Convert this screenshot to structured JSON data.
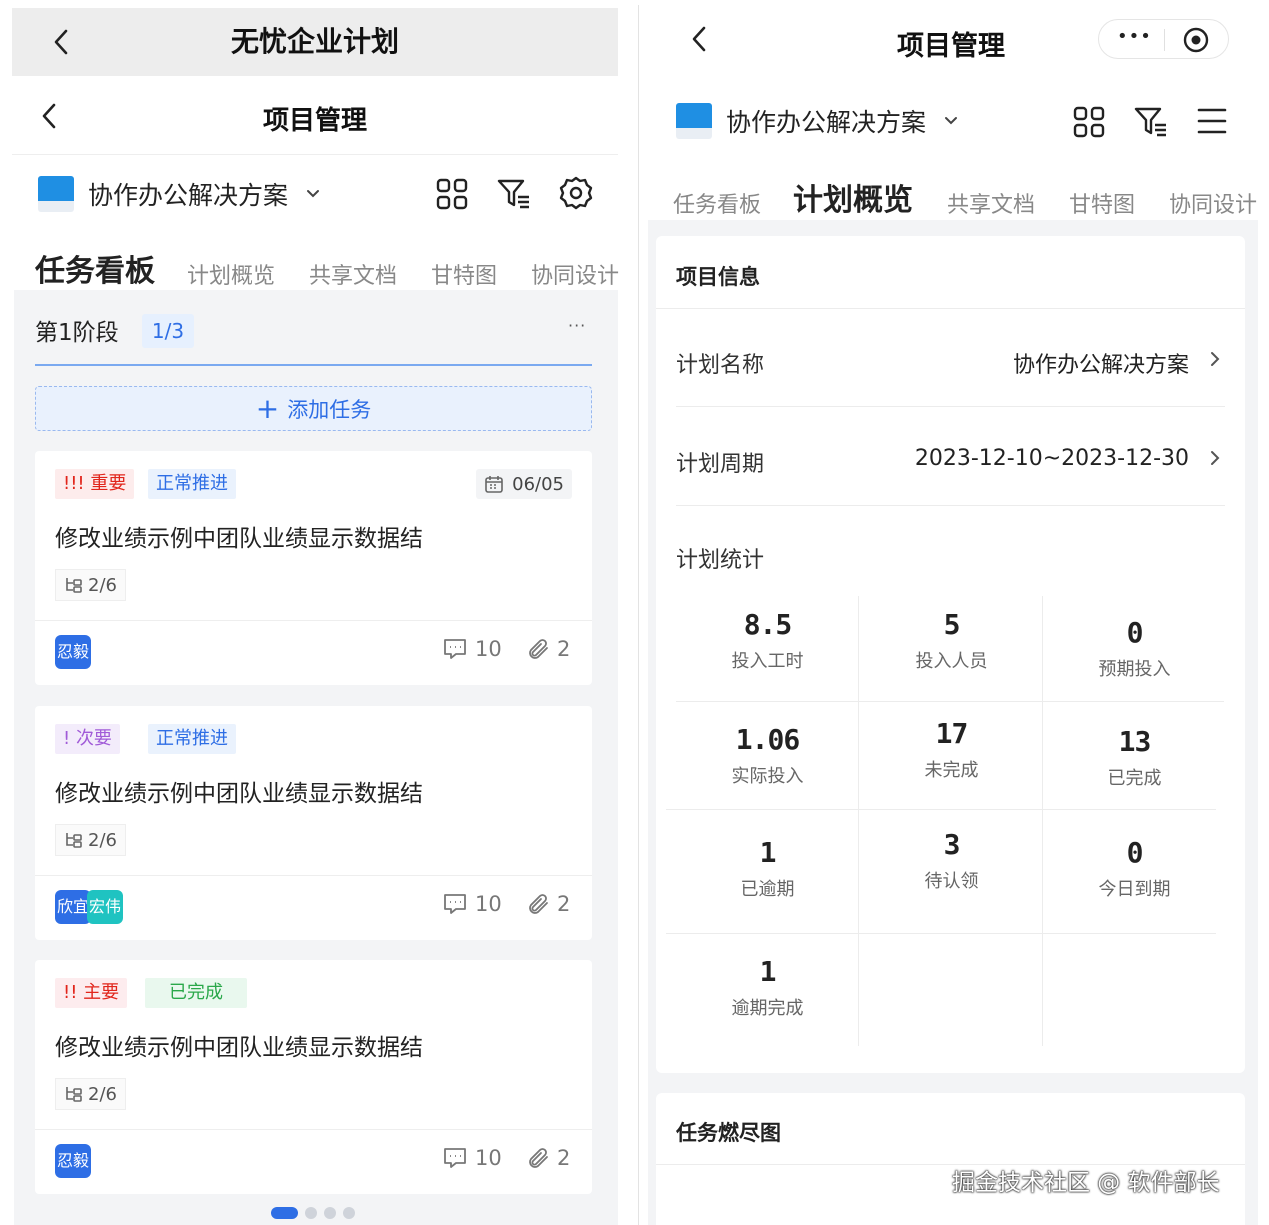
{
  "left": {
    "wechat_title": "无忧企业计划",
    "page_title": "项目管理",
    "project_name": "协作办公解决方案",
    "tabs": [
      "任务看板",
      "计划概览",
      "共享文档",
      "甘特图",
      "协同设计"
    ],
    "stage": {
      "title": "第1阶段",
      "badge": "1/3",
      "more": "···"
    },
    "add_task": "添加任务",
    "cards": [
      {
        "priority": "!!! 重要",
        "status": "正常推进",
        "date": "06/05",
        "title": "修改业绩示例中团队业绩显示数据结",
        "subtasks": "2/6",
        "avatars": [
          "忍毅"
        ],
        "comments": "10",
        "attachments": "2"
      },
      {
        "priority": "! 次要",
        "status": "正常推进",
        "title": "修改业绩示例中团队业绩显示数据结",
        "subtasks": "2/6",
        "avatars": [
          "欣宜",
          "宏伟"
        ],
        "comments": "10",
        "attachments": "2"
      },
      {
        "priority": "!! 主要",
        "status": "已完成",
        "title": "修改业绩示例中团队业绩显示数据结",
        "subtasks": "2/6",
        "avatars": [
          "忍毅"
        ],
        "comments": "10",
        "attachments": "2"
      }
    ],
    "pager": {
      "total": 4,
      "current": 1
    }
  },
  "right": {
    "page_title": "项目管理",
    "capsule": {
      "more": "•••"
    },
    "project_name": "协作办公解决方案",
    "tabs": [
      "任务看板",
      "计划概览",
      "共享文档",
      "甘特图",
      "协同设计"
    ],
    "info_title": "项目信息",
    "plan_name_label": "计划名称",
    "plan_name_value": "协作办公解决方案",
    "plan_period_label": "计划周期",
    "plan_period_value": "2023-12-10~2023-12-30",
    "stats_title": "计划统计",
    "stats": [
      {
        "value": "8.5",
        "label": "投入工时"
      },
      {
        "value": "5",
        "label": "投入人员"
      },
      {
        "value": "0",
        "label": "预期投入"
      },
      {
        "value": "1.06",
        "label": "实际投入"
      },
      {
        "value": "17",
        "label": "未完成"
      },
      {
        "value": "13",
        "label": "已完成"
      },
      {
        "value": "1",
        "label": "已逾期"
      },
      {
        "value": "3",
        "label": "待认领"
      },
      {
        "value": "0",
        "label": "今日到期"
      },
      {
        "value": "1",
        "label": "逾期完成"
      }
    ],
    "burndown_title": "任务燃尽图"
  },
  "watermark": "掘金技术社区 @ 软件部长",
  "colors": {
    "accent": "#2e6ee5",
    "important": "#e1251b",
    "minor": "#a15bd8",
    "done": "#2aa84a",
    "avatar_blue": "#2e6ee5",
    "avatar_teal": "#1fc3c1"
  }
}
